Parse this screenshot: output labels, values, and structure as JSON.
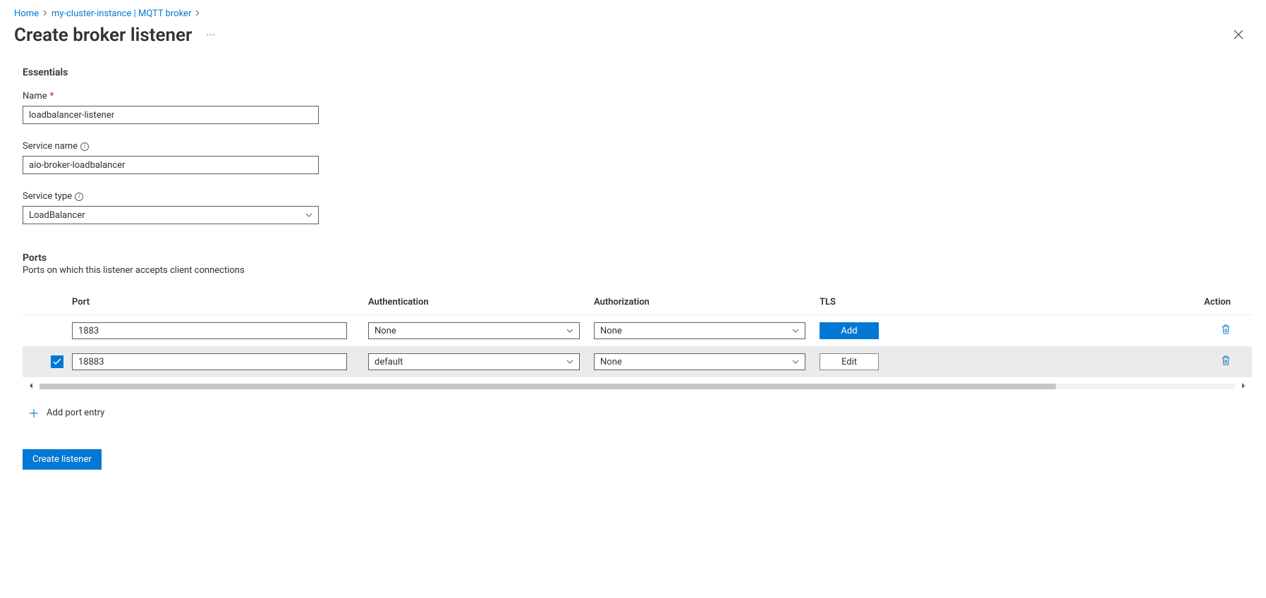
{
  "breadcrumb": {
    "home": "Home",
    "instance": "my-cluster-instance | MQTT broker"
  },
  "page": {
    "title": "Create broker listener"
  },
  "essentials": {
    "heading": "Essentials",
    "nameLabel": "Name",
    "nameValue": "loadbalancer-listener",
    "serviceNameLabel": "Service name",
    "serviceNameValue": "aio-broker-loadbalancer",
    "serviceTypeLabel": "Service type",
    "serviceTypeValue": "LoadBalancer"
  },
  "ports": {
    "heading": "Ports",
    "description": "Ports on which this listener accepts client connections",
    "columns": {
      "port": "Port",
      "authentication": "Authentication",
      "authorization": "Authorization",
      "tls": "TLS",
      "action": "Action"
    },
    "rows": [
      {
        "selected": false,
        "port": "1883",
        "authentication": "None",
        "authorization": "None",
        "tlsButton": "Add"
      },
      {
        "selected": true,
        "port": "18883",
        "authentication": "default",
        "authorization": "None",
        "tlsButton": "Edit"
      }
    ],
    "addLink": "Add port entry"
  },
  "footer": {
    "createButton": "Create listener"
  }
}
